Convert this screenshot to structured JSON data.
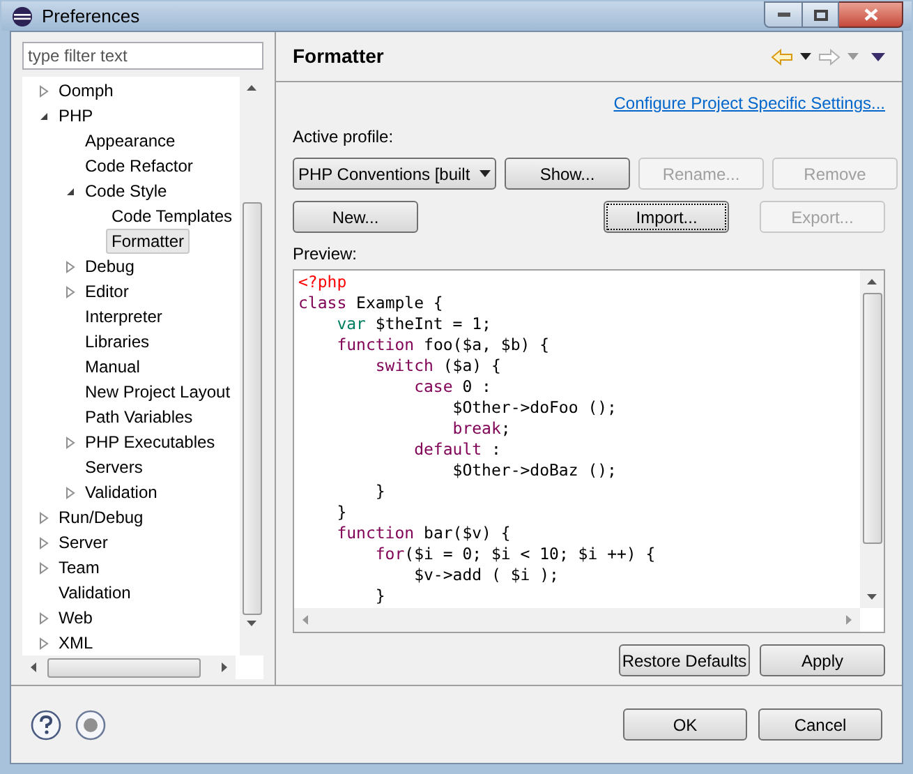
{
  "window": {
    "title": "Preferences"
  },
  "filter": {
    "placeholder": "type filter text"
  },
  "tree": [
    {
      "label": "Oomph",
      "kind": "folder",
      "expanded": false,
      "selected": false
    },
    {
      "label": "PHP",
      "kind": "folder",
      "expanded": true,
      "selected": false,
      "children": [
        {
          "label": "Appearance",
          "kind": "leaf",
          "selected": false
        },
        {
          "label": "Code Refactor",
          "kind": "leaf",
          "selected": false
        },
        {
          "label": "Code Style",
          "kind": "folder",
          "expanded": true,
          "selected": false,
          "children": [
            {
              "label": "Code Templates",
              "kind": "leaf",
              "selected": false
            },
            {
              "label": "Formatter",
              "kind": "leaf",
              "selected": true
            }
          ]
        },
        {
          "label": "Debug",
          "kind": "folder",
          "expanded": false,
          "selected": false
        },
        {
          "label": "Editor",
          "kind": "folder",
          "expanded": false,
          "selected": false
        },
        {
          "label": "Interpreter",
          "kind": "leaf",
          "selected": false
        },
        {
          "label": "Libraries",
          "kind": "leaf",
          "selected": false
        },
        {
          "label": "Manual",
          "kind": "leaf",
          "selected": false
        },
        {
          "label": "New Project Layout",
          "kind": "leaf",
          "selected": false
        },
        {
          "label": "Path Variables",
          "kind": "leaf",
          "selected": false
        },
        {
          "label": "PHP Executables",
          "kind": "folder",
          "expanded": false,
          "selected": false
        },
        {
          "label": "Servers",
          "kind": "leaf",
          "selected": false
        },
        {
          "label": "Validation",
          "kind": "folder",
          "expanded": false,
          "selected": false
        }
      ]
    },
    {
      "label": "Run/Debug",
      "kind": "folder",
      "expanded": false,
      "selected": false
    },
    {
      "label": "Server",
      "kind": "folder",
      "expanded": false,
      "selected": false
    },
    {
      "label": "Team",
      "kind": "folder",
      "expanded": false,
      "selected": false
    },
    {
      "label": "Validation",
      "kind": "leaf",
      "selected": false
    },
    {
      "label": "Web",
      "kind": "folder",
      "expanded": false,
      "selected": false
    },
    {
      "label": "XML",
      "kind": "folder",
      "expanded": false,
      "selected": false
    }
  ],
  "page": {
    "title": "Formatter",
    "link": "Configure Project Specific Settings...",
    "profile_label": "Active profile:",
    "profile": "PHP Conventions [built",
    "preview_label": "Preview:"
  },
  "profile_buttons": [
    {
      "label": "Show...",
      "disabled": false,
      "focused": false
    },
    {
      "label": "Rename...",
      "disabled": true,
      "focused": false
    },
    {
      "label": "Remove",
      "disabled": true,
      "focused": false
    }
  ],
  "action_buttons": [
    {
      "label": "New...",
      "disabled": false,
      "focused": false
    },
    {
      "label": "Import...",
      "disabled": false,
      "focused": true
    },
    {
      "label": "Export...",
      "disabled": true,
      "focused": false
    }
  ],
  "code": [
    [
      {
        "text": "<?php",
        "kind": "tag"
      }
    ],
    [
      {
        "text": "class",
        "kind": "keyword"
      },
      {
        "text": " Example {",
        "kind": "plain"
      }
    ],
    [
      {
        "text": "    var",
        "kind": "var"
      },
      {
        "text": " $theInt = 1;",
        "kind": "plain"
      }
    ],
    [
      {
        "text": "    function",
        "kind": "keyword"
      },
      {
        "text": " foo($a, $b) {",
        "kind": "plain"
      }
    ],
    [
      {
        "text": "        switch",
        "kind": "keyword"
      },
      {
        "text": " ($a) {",
        "kind": "plain"
      }
    ],
    [
      {
        "text": "            case",
        "kind": "keyword"
      },
      {
        "text": " 0 :",
        "kind": "plain"
      }
    ],
    [
      {
        "text": "                $Other->doFoo ();",
        "kind": "plain"
      }
    ],
    [
      {
        "text": "                break",
        "kind": "keyword"
      },
      {
        "text": ";",
        "kind": "plain"
      }
    ],
    [
      {
        "text": "            default",
        "kind": "keyword"
      },
      {
        "text": " :",
        "kind": "plain"
      }
    ],
    [
      {
        "text": "                $Other->doBaz ();",
        "kind": "plain"
      }
    ],
    [
      {
        "text": "        }",
        "kind": "plain"
      }
    ],
    [
      {
        "text": "    }",
        "kind": "plain"
      }
    ],
    [
      {
        "text": "    function",
        "kind": "keyword"
      },
      {
        "text": " bar($v) {",
        "kind": "plain"
      }
    ],
    [
      {
        "text": "        for",
        "kind": "keyword"
      },
      {
        "text": "($i = 0; $i < 10; $i ++) {",
        "kind": "plain"
      }
    ],
    [
      {
        "text": "            $v->add ( $i );",
        "kind": "plain"
      }
    ],
    [
      {
        "text": "        }",
        "kind": "plain"
      }
    ]
  ],
  "page_buttons": [
    "Restore Defaults",
    "Apply"
  ],
  "dialog_buttons": [
    "OK",
    "Cancel"
  ]
}
